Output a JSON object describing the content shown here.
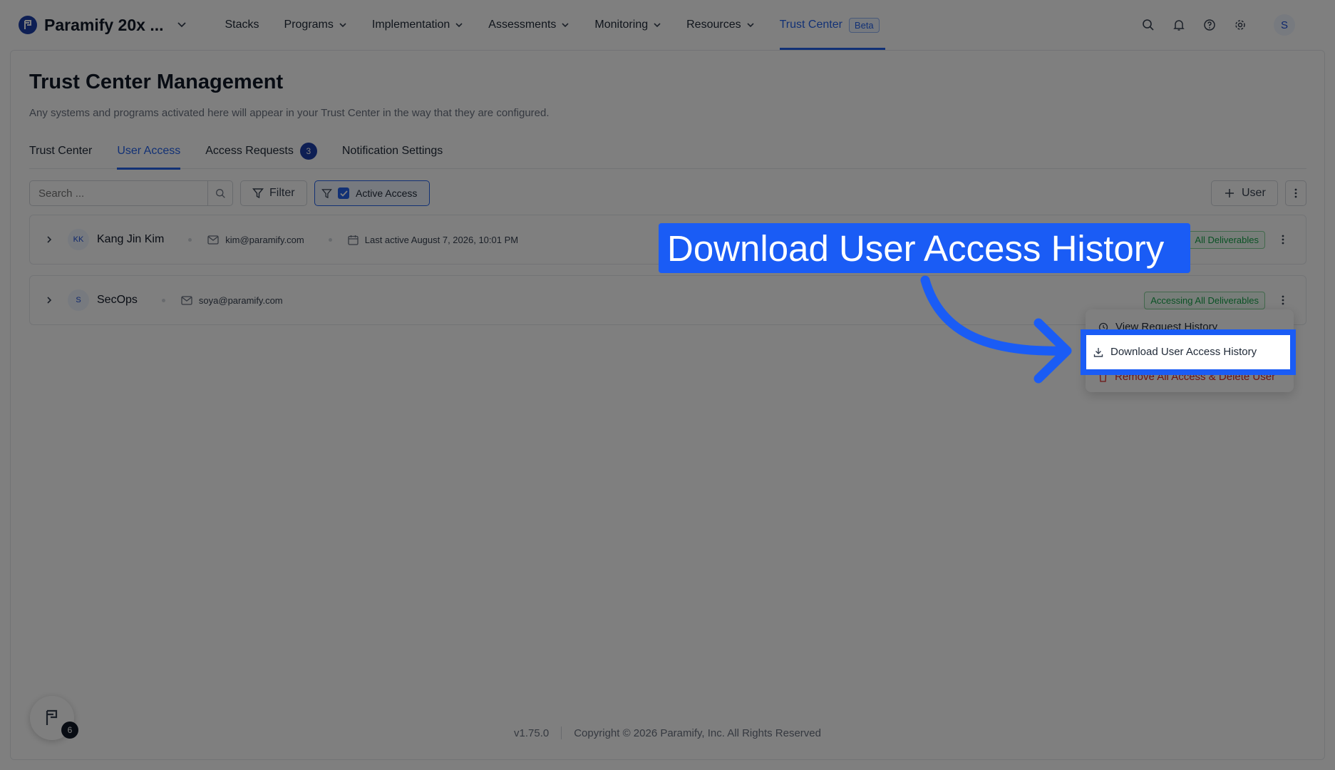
{
  "brand": {
    "name": "Paramify 20x ..."
  },
  "nav": {
    "items": [
      {
        "label": "Stacks",
        "dropdown": false
      },
      {
        "label": "Programs",
        "dropdown": true
      },
      {
        "label": "Implementation",
        "dropdown": true
      },
      {
        "label": "Assessments",
        "dropdown": true
      },
      {
        "label": "Monitoring",
        "dropdown": true
      },
      {
        "label": "Resources",
        "dropdown": true
      }
    ],
    "active": {
      "label": "Trust Center",
      "badge": "Beta"
    },
    "avatar": "S"
  },
  "page": {
    "title": "Trust Center Management",
    "subtitle": "Any systems and programs activated here will appear in your Trust Center in the way that they are configured."
  },
  "tabs": {
    "trust_center": "Trust Center",
    "user_access": "User Access",
    "access_requests": "Access Requests",
    "access_requests_count": "3",
    "notification_settings": "Notification Settings"
  },
  "toolbar": {
    "search_placeholder": "Search ...",
    "filter_label": "Filter",
    "active_access_label": "Active Access",
    "add_user_label": "User"
  },
  "users": [
    {
      "initials": "KK",
      "name": "Kang Jin Kim",
      "email": "kim@paramify.com",
      "last_active": "Last active August 7, 2026, 10:01 PM",
      "status": "All Deliverables"
    },
    {
      "initials": "S",
      "name": "SecOps",
      "email": "soya@paramify.com",
      "status": "Accessing All Deliverables"
    }
  ],
  "menu": {
    "view_history": "View Request History",
    "download_history": "Download User Access History",
    "remove_user": "Remove All Access & Delete User"
  },
  "footer": {
    "version": "v1.75.0",
    "copyright": "Copyright © 2026 Paramify, Inc. All Rights Reserved"
  },
  "fab": {
    "count": "6"
  },
  "annotation": {
    "callout": "Download User Access History",
    "accent_color": "#1a5cf5"
  }
}
